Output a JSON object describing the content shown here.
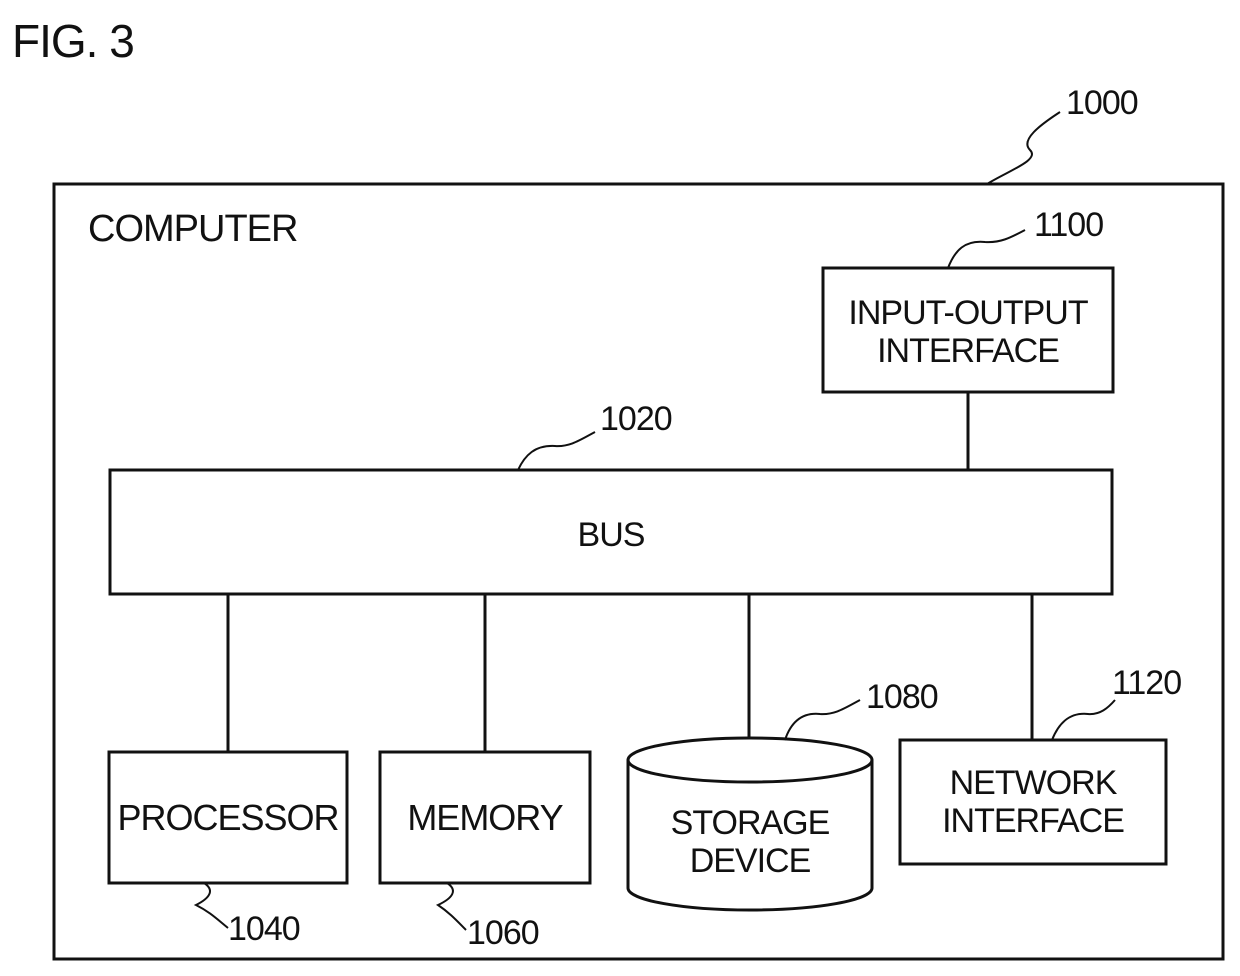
{
  "figure": {
    "title": "FIG. 3",
    "computer": {
      "label": "COMPUTER",
      "ref": "1000"
    },
    "bus": {
      "label": "BUS",
      "ref": "1020"
    },
    "input_output_interface": {
      "label_line1": "INPUT-OUTPUT",
      "label_line2": "INTERFACE",
      "ref": "1100"
    },
    "processor": {
      "label": "PROCESSOR",
      "ref": "1040"
    },
    "memory": {
      "label": "MEMORY",
      "ref": "1060"
    },
    "storage_device": {
      "label_line1": "STORAGE",
      "label_line2": "DEVICE",
      "ref": "1080"
    },
    "network_interface": {
      "label_line1": "NETWORK",
      "label_line2": "INTERFACE",
      "ref": "1120"
    }
  }
}
